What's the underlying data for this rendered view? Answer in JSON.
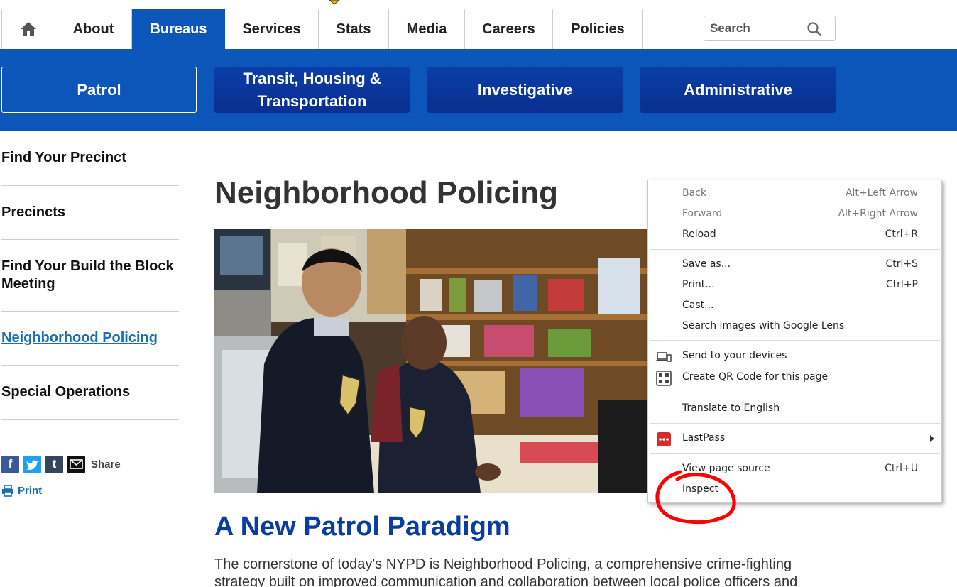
{
  "nav": {
    "home_icon": "home-icon",
    "items": [
      "About",
      "Bureaus",
      "Services",
      "Stats",
      "Media",
      "Careers",
      "Policies"
    ],
    "active": "Bureaus",
    "search_placeholder": "Search",
    "search_icon": "search-icon"
  },
  "subnav": {
    "items": [
      "Patrol",
      "Transit, Housing & Transportation",
      "Investigative",
      "Administrative"
    ],
    "active": "Patrol"
  },
  "sidebar": {
    "items": [
      "Find Your Precinct",
      "Precincts",
      "Find Your Build the Block Meeting",
      "Neighborhood Policing",
      "Special Operations"
    ],
    "active": "Neighborhood Policing",
    "share_label": "Share",
    "print_label": "Print"
  },
  "main": {
    "title": "Neighborhood Policing",
    "section_title": "A New Patrol Paradigm",
    "body": "The cornerstone of today's NYPD is Neighborhood Policing, a comprehensive crime-fighting strategy built on improved communication and collaboration between local police officers and"
  },
  "context_menu": {
    "groups": [
      [
        {
          "label": "Back",
          "shortcut": "Alt+Left Arrow",
          "disabled": true
        },
        {
          "label": "Forward",
          "shortcut": "Alt+Right Arrow",
          "disabled": true
        },
        {
          "label": "Reload",
          "shortcut": "Ctrl+R",
          "disabled": false
        }
      ],
      [
        {
          "label": "Save as...",
          "shortcut": "Ctrl+S",
          "disabled": false
        },
        {
          "label": "Print...",
          "shortcut": "Ctrl+P",
          "disabled": false
        },
        {
          "label": "Cast...",
          "shortcut": "",
          "disabled": false
        },
        {
          "label": "Search images with Google Lens",
          "shortcut": "",
          "disabled": false
        }
      ],
      [
        {
          "label": "Send to your devices",
          "icon": "devices-icon"
        },
        {
          "label": "Create QR Code for this page",
          "icon": "qr-code-icon"
        }
      ],
      [
        {
          "label": "Translate to English"
        }
      ],
      [
        {
          "label": "LastPass",
          "icon": "lastpass-icon",
          "submenu": true
        }
      ],
      [
        {
          "label": "View page source",
          "shortcut": "Ctrl+U"
        },
        {
          "label": "Inspect",
          "shortcut": ""
        }
      ]
    ]
  },
  "colors": {
    "brand_blue": "#0b56b8",
    "dark_button_blue": "#0a3ea8",
    "section_title": "#0b3e9c",
    "link": "#1a6fb0",
    "annotation_red": "#ff0000"
  }
}
